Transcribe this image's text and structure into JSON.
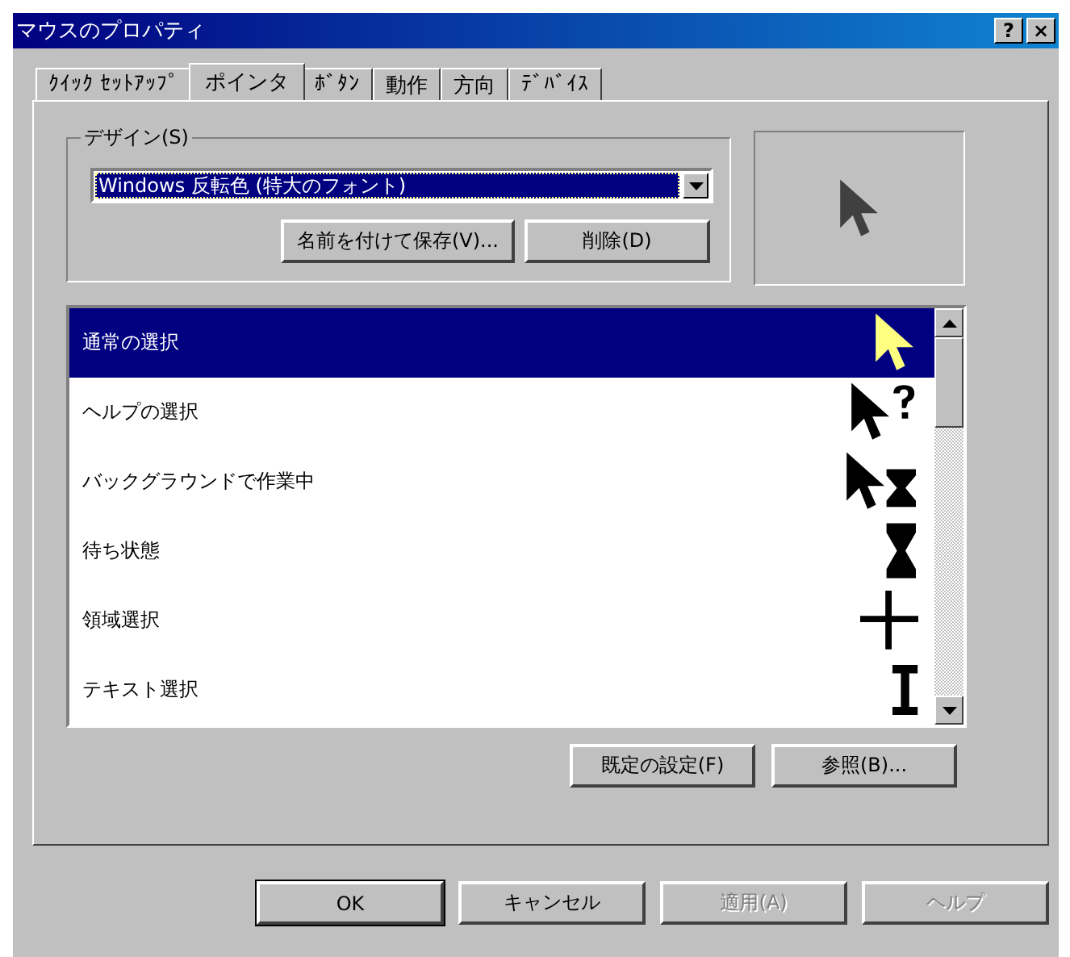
{
  "window": {
    "title": "マウスのプロパティ",
    "title_buttons": [
      "?",
      "×"
    ]
  },
  "tabs": [
    {
      "label": "ｸｲｯｸ ｾｯﾄｱｯﾌﾟ",
      "selected": false
    },
    {
      "label": "ポインタ",
      "selected": true
    },
    {
      "label": "ﾎﾞﾀﾝ",
      "selected": false
    },
    {
      "label": "動作",
      "selected": false
    },
    {
      "label": "方向",
      "selected": false
    },
    {
      "label": "ﾃﾞﾊﾞｲｽ",
      "selected": false
    }
  ],
  "design": {
    "label": "デザイン(S)",
    "value": "Windows 反転色 (特大のフォント)",
    "buttons": [
      {
        "label": "名前を付けて保存(V)...",
        "disabled": false
      },
      {
        "label": "削除(D)",
        "disabled": false
      }
    ]
  },
  "preview": {
    "kind": "arrow"
  },
  "pointers": [
    {
      "name": "通常の選択",
      "kind": "arrow",
      "selected": true
    },
    {
      "name": "ヘルプの選択",
      "kind": "help",
      "selected": false
    },
    {
      "name": "バックグラウンドで作業中",
      "kind": "working",
      "selected": false
    },
    {
      "name": "待ち状態",
      "kind": "busy",
      "selected": false
    },
    {
      "name": "領域選択",
      "kind": "cross",
      "selected": false
    },
    {
      "name": "テキスト選択",
      "kind": "text",
      "selected": false
    }
  ],
  "list_buttons": [
    {
      "label": "既定の設定(F)",
      "disabled": false
    },
    {
      "label": "参照(B)...",
      "disabled": false
    }
  ],
  "dialog_buttons": [
    {
      "label": "OK",
      "default": true,
      "disabled": false
    },
    {
      "label": "キャンセル",
      "default": false,
      "disabled": false
    },
    {
      "label": "適用(A)",
      "default": false,
      "disabled": true
    },
    {
      "label": "ヘルプ",
      "default": false,
      "disabled": true
    }
  ]
}
